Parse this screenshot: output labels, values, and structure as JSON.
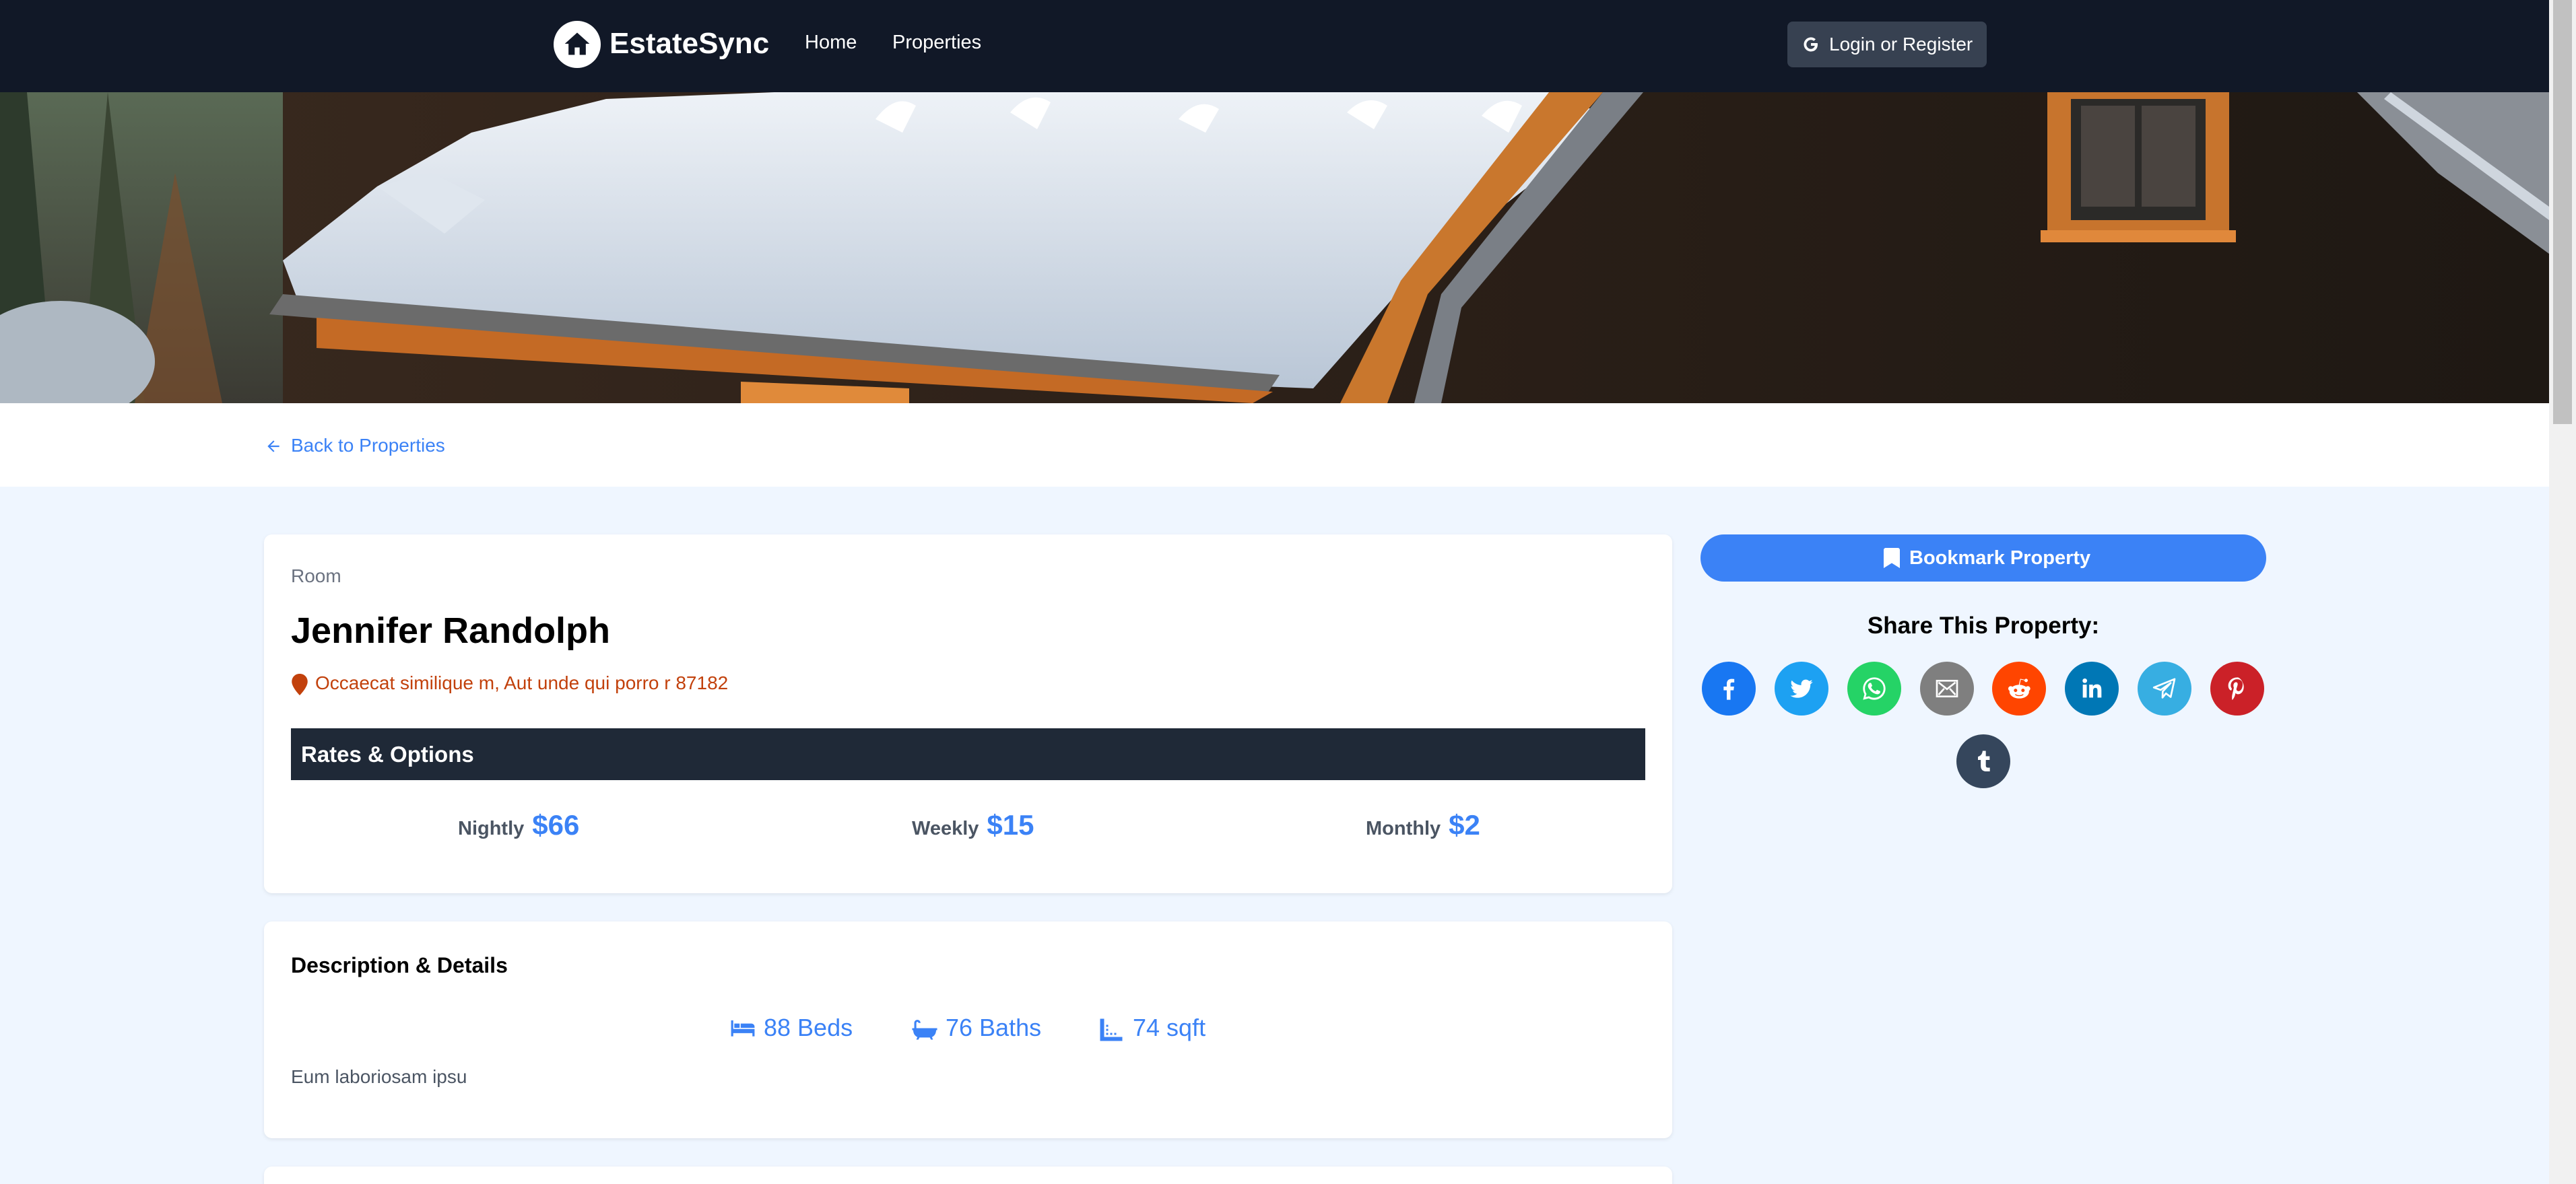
{
  "nav": {
    "brand": "EstateSync",
    "links": [
      "Home",
      "Properties"
    ],
    "login_label": "Login or Register"
  },
  "back_link": "Back to Properties",
  "property": {
    "type": "Room",
    "title": "Jennifer Randolph",
    "address": "Occaecat similique m, Aut unde qui porro r 87182",
    "rates_heading": "Rates & Options",
    "rates": [
      {
        "label": "Nightly",
        "value": "$66"
      },
      {
        "label": "Weekly",
        "value": "$15"
      },
      {
        "label": "Monthly",
        "value": "$2"
      }
    ]
  },
  "details": {
    "heading": "Description & Details",
    "features": [
      {
        "icon": "bed-icon",
        "text": "88 Beds"
      },
      {
        "icon": "bath-icon",
        "text": "76 Baths"
      },
      {
        "icon": "ruler-icon",
        "text": "74 sqft"
      }
    ],
    "description": "Eum laboriosam ipsu"
  },
  "sidebar": {
    "bookmark_label": "Bookmark Property",
    "share_heading": "Share This Property:",
    "share": [
      {
        "name": "facebook-share-icon",
        "color": "#1877f2"
      },
      {
        "name": "twitter-share-icon",
        "color": "#1da1f2"
      },
      {
        "name": "whatsapp-share-icon",
        "color": "#25d366"
      },
      {
        "name": "email-share-icon",
        "color": "#7f7f7f"
      },
      {
        "name": "reddit-share-icon",
        "color": "#ff4500"
      },
      {
        "name": "linkedin-share-icon",
        "color": "#0077b5"
      },
      {
        "name": "telegram-share-icon",
        "color": "#37aee2"
      },
      {
        "name": "pinterest-share-icon",
        "color": "#cb2128"
      },
      {
        "name": "tumblr-share-icon",
        "color": "#35465c"
      }
    ]
  },
  "colors": {
    "accent": "#3b82f6",
    "nav_bg": "#111827",
    "rates_bar": "#1f2937",
    "page_bg": "#eff6ff",
    "address": "#c2410c"
  }
}
